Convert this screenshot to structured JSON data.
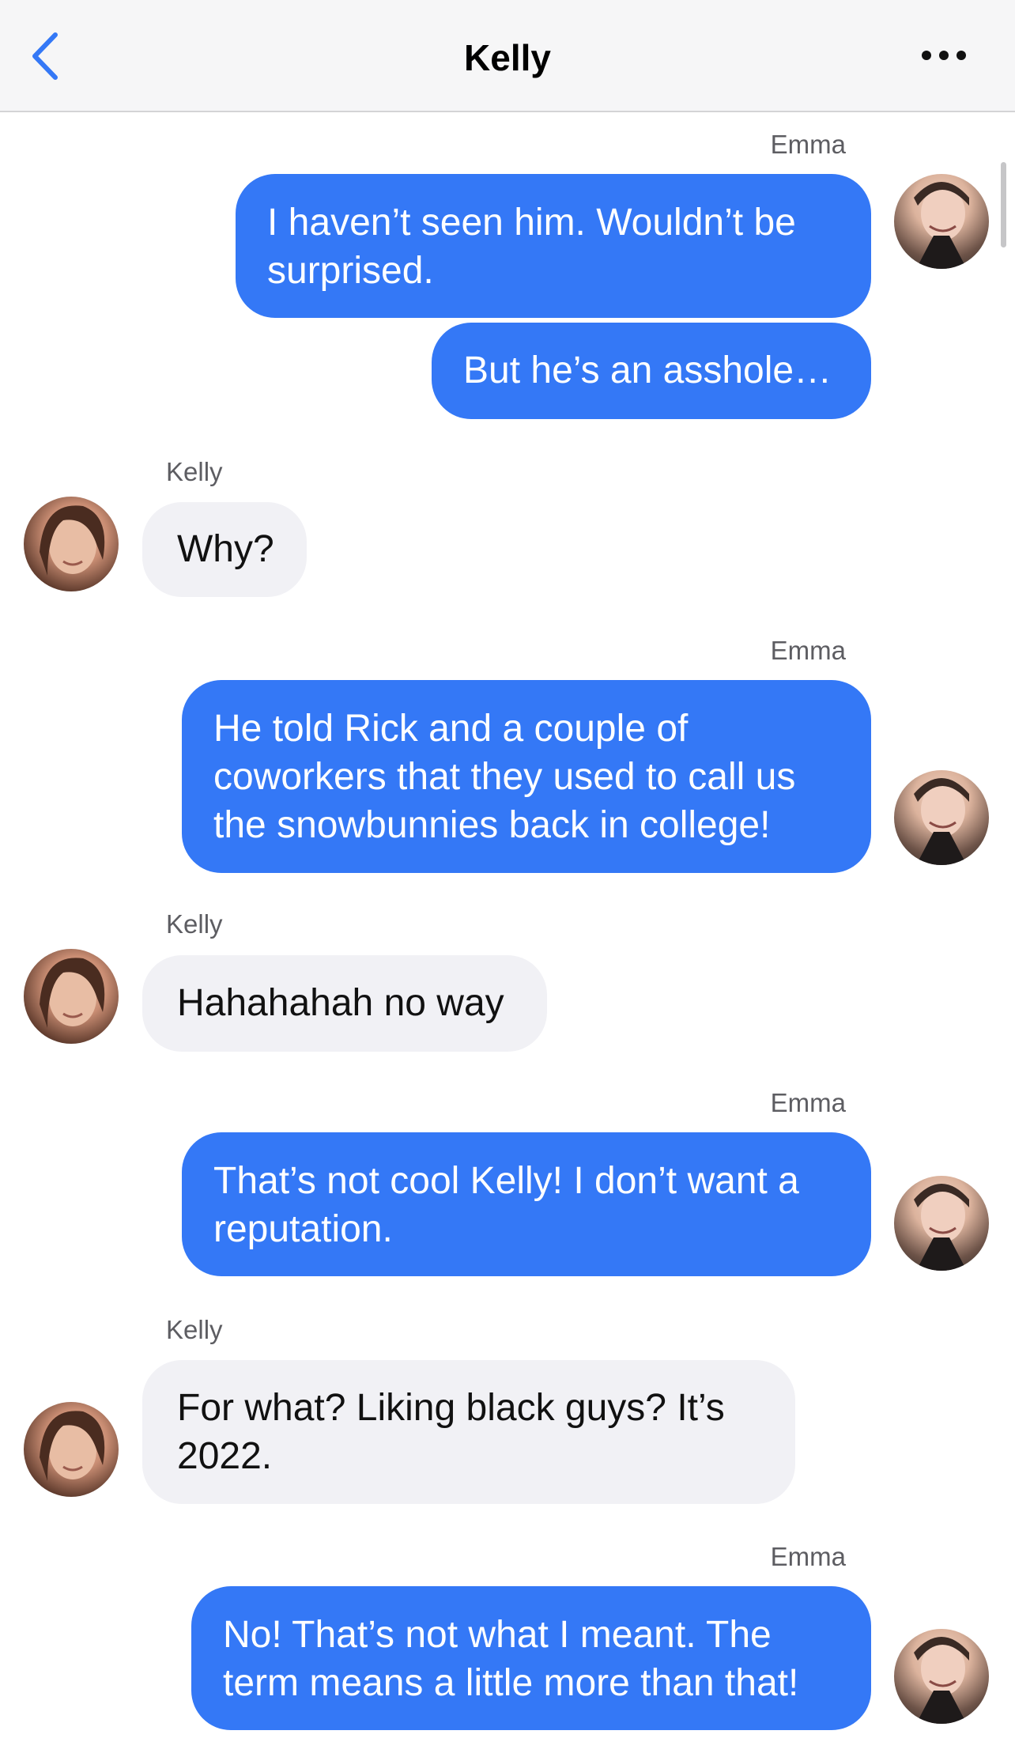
{
  "header": {
    "title": "Kelly",
    "back_icon": "chevron-left-icon",
    "more_icon": "ellipsis-icon"
  },
  "colors": {
    "outgoing_bubble": "#3478f6",
    "incoming_bubble": "#f1f1f5",
    "back_chevron": "#3478f6"
  },
  "messages": [
    {
      "sender": "Emma",
      "direction": "outgoing",
      "bubbles": [
        "I haven’t seen him. Wouldn’t be surprised.",
        "But he’s an asshole…"
      ]
    },
    {
      "sender": "Kelly",
      "direction": "incoming",
      "bubbles": [
        "Why?"
      ]
    },
    {
      "sender": "Emma",
      "direction": "outgoing",
      "bubbles": [
        "He told Rick and a couple of coworkers that they used to call us the snowbunnies back in college!"
      ]
    },
    {
      "sender": "Kelly",
      "direction": "incoming",
      "bubbles": [
        "Hahahahah no way"
      ]
    },
    {
      "sender": "Emma",
      "direction": "outgoing",
      "bubbles": [
        "That’s not cool Kelly! I don’t want a reputation."
      ]
    },
    {
      "sender": "Kelly",
      "direction": "incoming",
      "bubbles": [
        "For what? Liking black guys? It’s 2022."
      ]
    },
    {
      "sender": "Emma",
      "direction": "outgoing",
      "bubbles": [
        "No! That’s not what I meant. The term means a little more than that!"
      ]
    }
  ]
}
